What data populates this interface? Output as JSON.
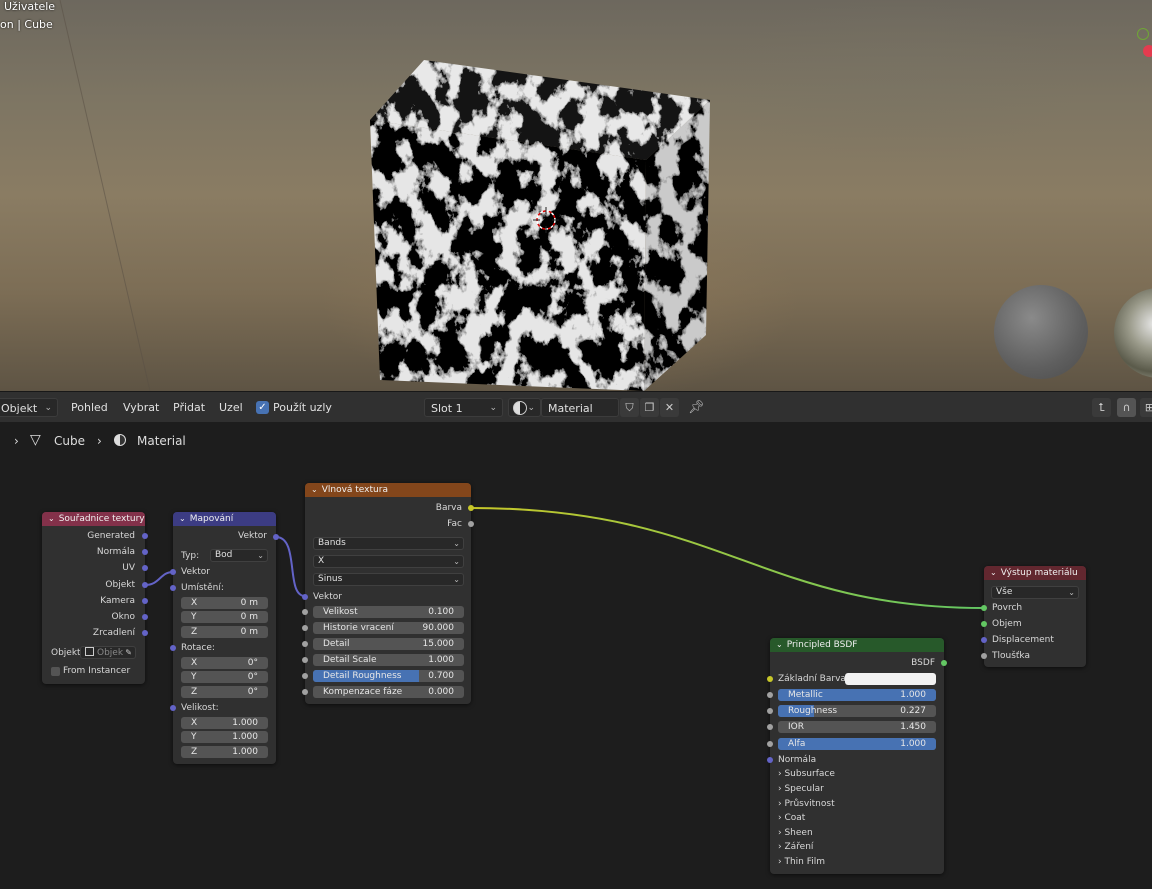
{
  "viewport": {
    "corner_text_1": "Uživatele",
    "corner_text_2": "on | Cube"
  },
  "header": {
    "mode_dropdown": "Objekt",
    "menus": [
      "Pohled",
      "Vybrat",
      "Přidat",
      "Uzel"
    ],
    "use_nodes_label": "Použít uzly",
    "use_nodes_checked": true,
    "slot_dropdown": "Slot 1",
    "material_name": "Material"
  },
  "breadcrumb": {
    "object": "Cube",
    "material": "Material"
  },
  "nodes": {
    "texcoord": {
      "title": "Souřadnice textury",
      "outputs": [
        "Generated",
        "Normála",
        "UV",
        "Objekt",
        "Kamera",
        "Okno",
        "Zrcadlení"
      ],
      "object_label": "Objekt:",
      "object_placeholder": "Objek",
      "from_instancer": "From Instancer"
    },
    "mapping": {
      "title": "Mapování",
      "output": "Vektor",
      "type_label": "Typ:",
      "type_value": "Bod",
      "vector_input": "Vektor",
      "location_label": "Umístění:",
      "location": [
        {
          "axis": "X",
          "value": "0 m"
        },
        {
          "axis": "Y",
          "value": "0 m"
        },
        {
          "axis": "Z",
          "value": "0 m"
        }
      ],
      "rotation_label": "Rotace:",
      "rotation": [
        {
          "axis": "X",
          "value": "0°"
        },
        {
          "axis": "Y",
          "value": "0°"
        },
        {
          "axis": "Z",
          "value": "0°"
        }
      ],
      "scale_label": "Velikost:",
      "scale": [
        {
          "axis": "X",
          "value": "1.000"
        },
        {
          "axis": "Y",
          "value": "1.000"
        },
        {
          "axis": "Z",
          "value": "1.000"
        }
      ]
    },
    "wave": {
      "title": "Vlnová textura",
      "outputs": [
        "Barva",
        "Fac"
      ],
      "wave_type": "Bands",
      "direction": "X",
      "profile": "Sinus",
      "vector_input": "Vektor",
      "fields": [
        {
          "label": "Velikost",
          "value": "0.100",
          "fill": 0
        },
        {
          "label": "Historie vracení",
          "value": "90.000",
          "fill": 0
        },
        {
          "label": "Detail",
          "value": "15.000",
          "fill": 0
        },
        {
          "label": "Detail Scale",
          "value": "1.000",
          "fill": 0
        },
        {
          "label": "Detail Roughness",
          "value": "0.700",
          "fill": 0.7
        },
        {
          "label": "Kompenzace fáze",
          "value": "0.000",
          "fill": 0
        }
      ]
    },
    "bsdf": {
      "title": "Principled BSDF",
      "output": "BSDF",
      "base_color_label": "Základní Barva",
      "base_color": "#f2f2f2",
      "fields": [
        {
          "label": "Metallic",
          "value": "1.000",
          "fill": 1
        },
        {
          "label": "Roughness",
          "value": "0.227",
          "fill": 0.227
        },
        {
          "label": "IOR",
          "value": "1.450",
          "fill": 0
        },
        {
          "label": "Alfa",
          "value": "1.000",
          "fill": 1
        }
      ],
      "normal_label": "Normála",
      "panels": [
        "Subsurface",
        "Specular",
        "Průsvitnost",
        "Coat",
        "Sheen",
        "Záření",
        "Thin Film"
      ]
    },
    "output": {
      "title": "Výstup materiálu",
      "target": "Vše",
      "inputs": [
        "Povrch",
        "Objem",
        "Displacement",
        "Tloušťka"
      ]
    }
  },
  "colors": {
    "texcoord_header": "#83314a",
    "mapping_header": "#3c3c83",
    "wave_header": "#83461b",
    "bsdf_header": "#27592a",
    "output_header": "#62272f",
    "vector_socket": "#6363c7",
    "color_socket": "#c7c729",
    "shader_socket": "#63c763",
    "slider_fill": "#4772b3"
  }
}
